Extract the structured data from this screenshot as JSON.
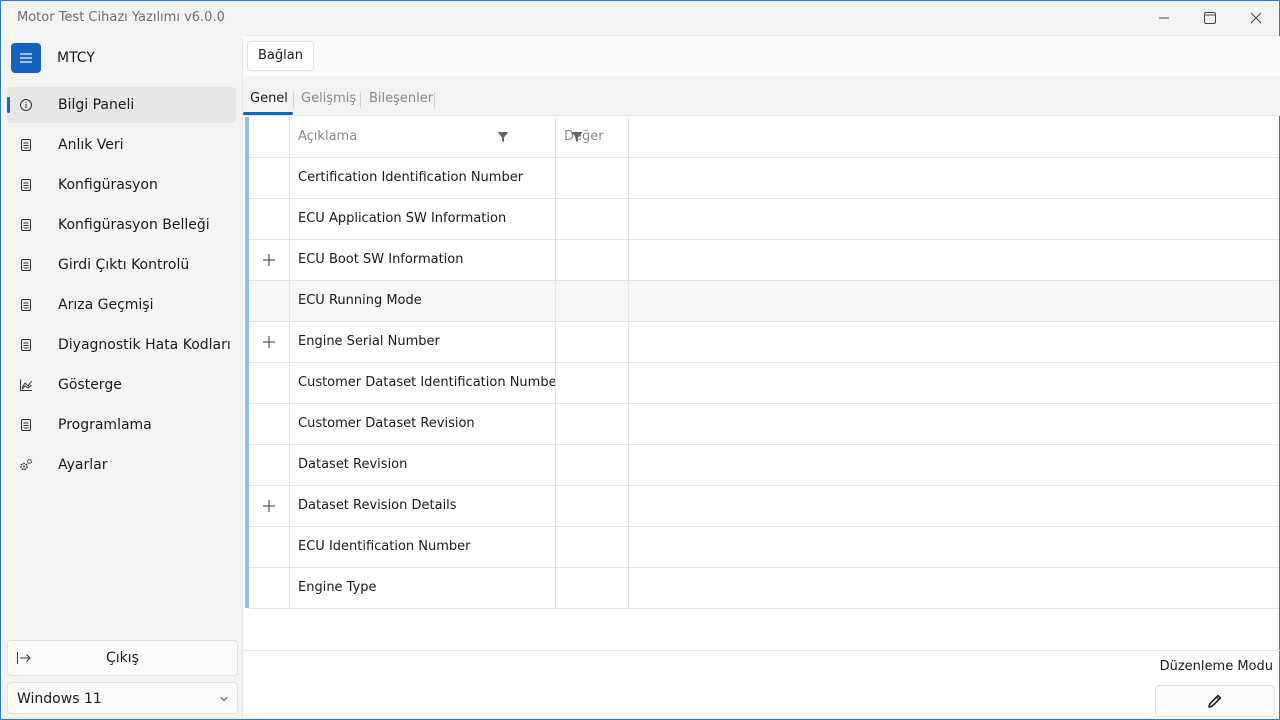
{
  "window": {
    "title": "Motor Test Cihazı Yazılımı v6.0.0"
  },
  "sidebar": {
    "app_abbr": "MTCY",
    "items": [
      {
        "label": "Bilgi Paneli",
        "icon": "info-icon",
        "active": true
      },
      {
        "label": "Anlık Veri",
        "icon": "document-icon"
      },
      {
        "label": "Konfigürasyon",
        "icon": "document-icon"
      },
      {
        "label": "Konfigürasyon Belleği",
        "icon": "document-icon"
      },
      {
        "label": "Girdi Çıktı Kontrolü",
        "icon": "document-icon"
      },
      {
        "label": "Arıza Geçmişi",
        "icon": "document-icon"
      },
      {
        "label": "Diyagnostik Hata Kodları",
        "icon": "document-icon"
      },
      {
        "label": "Gösterge",
        "icon": "chart-icon"
      },
      {
        "label": "Programlama",
        "icon": "document-icon"
      },
      {
        "label": "Ayarlar",
        "icon": "gears-icon"
      }
    ],
    "exit_label": "Çıkış",
    "os_select_value": "Windows 11"
  },
  "toolbar": {
    "connect_label": "Bağlan"
  },
  "tabs": [
    {
      "label": "Genel",
      "active": true
    },
    {
      "label": "Gelişmiş"
    },
    {
      "label": "Bileşenler"
    }
  ],
  "grid": {
    "columns": {
      "description": "Açıklama",
      "value": "Değer"
    },
    "rows": [
      {
        "description": "Certification Identification Number",
        "value": "",
        "expandable": false
      },
      {
        "description": "ECU Application SW Information",
        "value": "",
        "expandable": false
      },
      {
        "description": "ECU Boot SW Information",
        "value": "",
        "expandable": true
      },
      {
        "description": "ECU Running Mode",
        "value": "",
        "expandable": false,
        "selected": true
      },
      {
        "description": "Engine Serial Number",
        "value": "",
        "expandable": true
      },
      {
        "description": "Customer Dataset Identification Number",
        "value": "",
        "expandable": false
      },
      {
        "description": "Customer Dataset Revision",
        "value": "",
        "expandable": false
      },
      {
        "description": "Dataset Revision",
        "value": "",
        "expandable": false
      },
      {
        "description": "Dataset Revision Details",
        "value": "",
        "expandable": true
      },
      {
        "description": "ECU Identification Number",
        "value": "",
        "expandable": false
      },
      {
        "description": "Engine Type",
        "value": "",
        "expandable": false
      }
    ]
  },
  "footer": {
    "edit_mode_label": "Düzenleme Modu"
  },
  "colors": {
    "accent": "#1463bf",
    "grid_bar": "#8dbde9"
  }
}
